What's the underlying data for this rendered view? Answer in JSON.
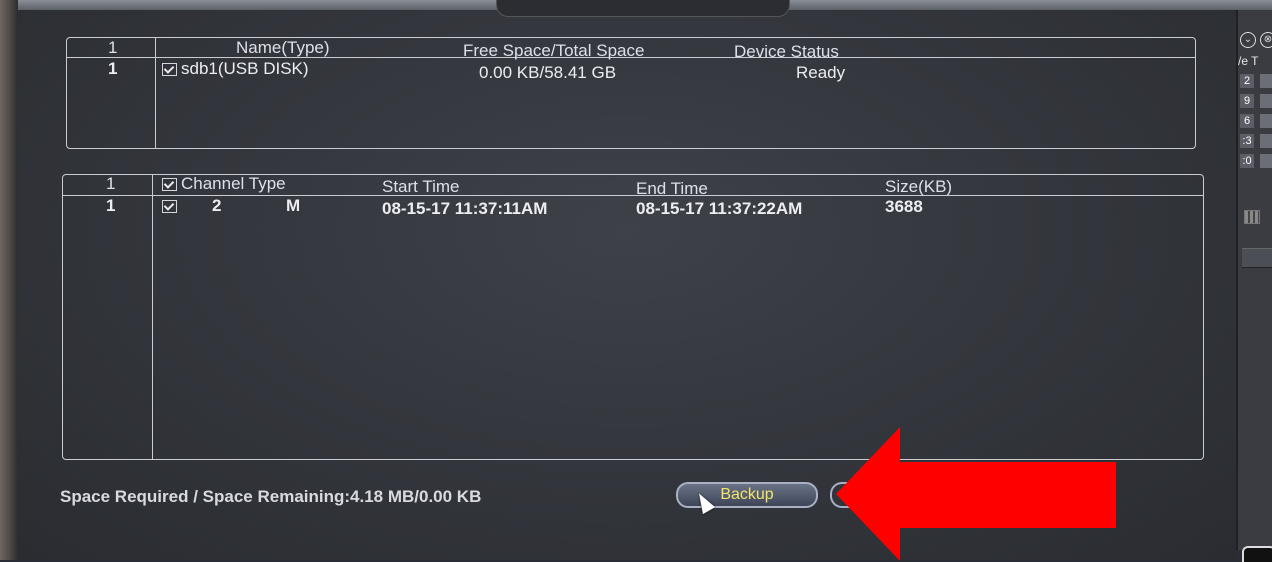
{
  "device_table": {
    "headers": {
      "index": "1",
      "name": "Name(Type)",
      "space": "Free Space/Total Space",
      "status": "Device Status"
    },
    "rows": [
      {
        "index": "1",
        "name": "sdb1(USB DISK)",
        "space": "0.00 KB/58.41 GB",
        "status": "Ready",
        "checked": true
      }
    ]
  },
  "file_table": {
    "headers": {
      "index": "1",
      "channel_type": "Channel Type",
      "start": "Start Time",
      "end": "End Time",
      "size": "Size(KB)"
    },
    "rows": [
      {
        "index": "1",
        "channel": "2",
        "type": "M",
        "start": "08-15-17 11:37:11AM",
        "end": "08-15-17 11:37:22AM",
        "size": "3688",
        "checked": true
      }
    ]
  },
  "footer": {
    "space_label": "Space Required / Space Remaining:4.18 MB/0.00 KB",
    "backup_button": "Backup"
  },
  "right_panel": {
    "header_text": "/e T",
    "cells": [
      "2",
      "9",
      "6",
      ":3",
      ":0"
    ]
  },
  "colors": {
    "annotation_arrow": "#ff0000",
    "button_text": "#f3e56b"
  }
}
